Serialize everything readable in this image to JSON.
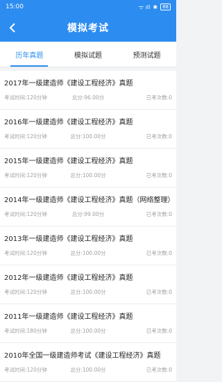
{
  "status": {
    "time": "15:00",
    "signal": "ᯤ ıll",
    "battery": "88"
  },
  "nav": {
    "title": "模拟考试"
  },
  "tabs": [
    {
      "label": "历年真题"
    },
    {
      "label": "模拟试题"
    },
    {
      "label": "预测试题"
    }
  ],
  "items": [
    {
      "title": "2017年一级建造师《建设工程经济》真题",
      "time": "考试时间:120分钟",
      "score": "总分:96.00分",
      "count": "已考次数:0"
    },
    {
      "title": "2016年一级建造师《建设工程经济》真题",
      "time": "考试时间:120分钟",
      "score": "总分:100.00分",
      "count": "已考次数:0"
    },
    {
      "title": "2015年一级建造师《建设工程经济》真题",
      "time": "考试时间:120分钟",
      "score": "总分:100.00分",
      "count": "已考次数:0"
    },
    {
      "title": "2014年一级建造师《建设工程经济》真题（网络整理）",
      "time": "考试时间:120分钟",
      "score": "总分:99.00分",
      "count": "已考次数:0"
    },
    {
      "title": "2013年一级建造师《建设工程经济》真题",
      "time": "考试时间:120分钟",
      "score": "总分:100.00分",
      "count": "已考次数:0"
    },
    {
      "title": "2012年一级建造师《建设工程经济》真题",
      "time": "考试时间:120分钟",
      "score": "总分:100.00分",
      "count": "已考次数:0"
    },
    {
      "title": "2011年一级建造师《建设工程经济》真题",
      "time": "考试时间:180分钟",
      "score": "总分:100.00分",
      "count": "已考次数:0"
    },
    {
      "title": "2010年全国一级建造师考试《建设工程经济》真题",
      "time": "考试时间:120分钟",
      "score": "总分:100.00分",
      "count": "已考次数:0"
    }
  ]
}
